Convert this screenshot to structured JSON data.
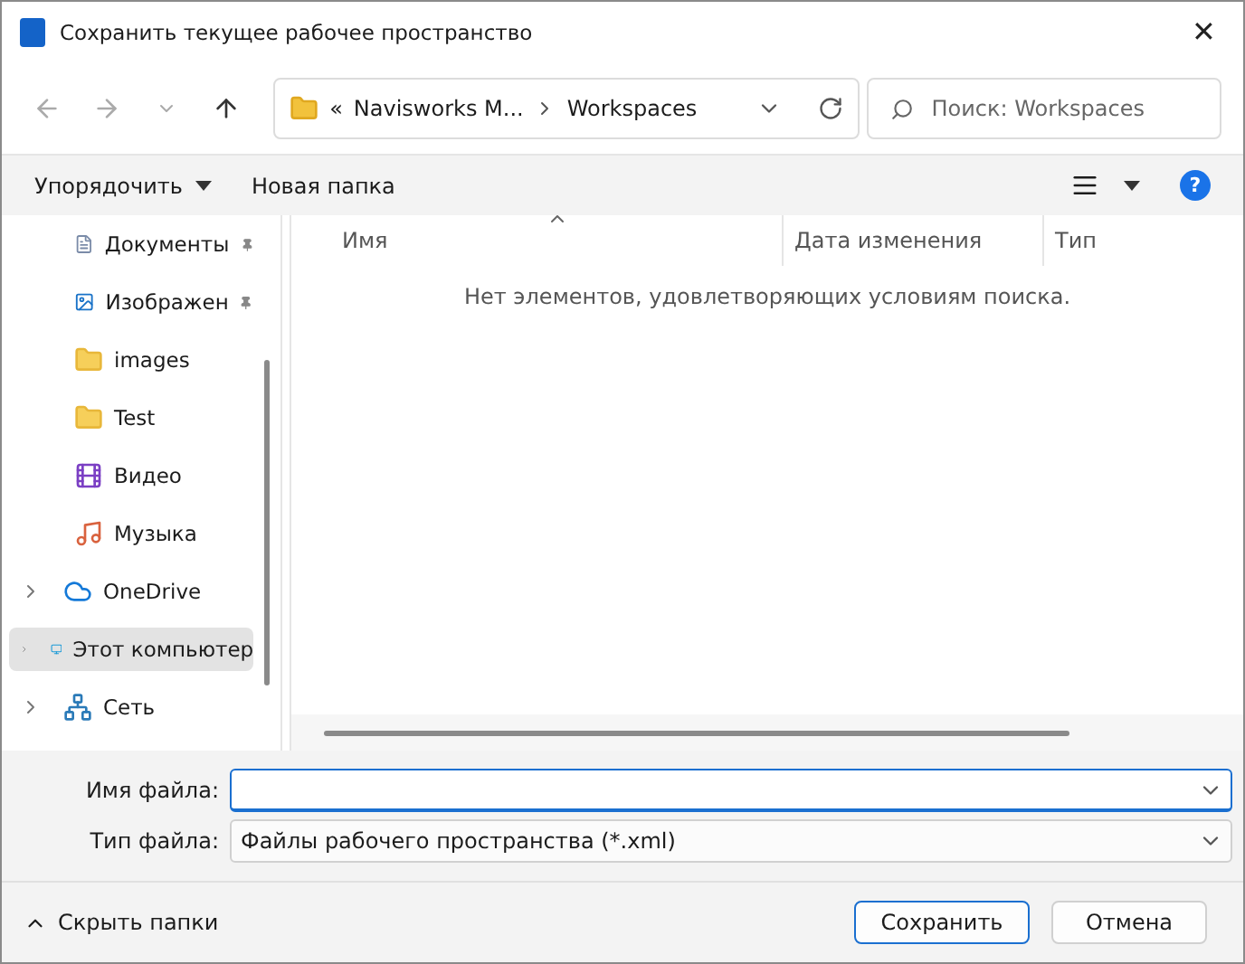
{
  "window": {
    "title": "Сохранить текущее рабочее пространство",
    "close": "✕"
  },
  "address": {
    "overflow": "«",
    "segments": [
      "Navisworks M...",
      "Workspaces"
    ]
  },
  "search": {
    "placeholder": "Поиск: Workspaces"
  },
  "toolbar": {
    "organize": "Упорядочить",
    "new_folder": "Новая папка",
    "help": "?"
  },
  "sidebar": {
    "items": [
      {
        "label": "Документы",
        "kind": "documents",
        "pinned": true,
        "expandable": false,
        "selected": false
      },
      {
        "label": "Изображен",
        "kind": "pictures",
        "pinned": true,
        "expandable": false,
        "selected": false
      },
      {
        "label": "images",
        "kind": "folder",
        "pinned": false,
        "expandable": false,
        "selected": false
      },
      {
        "label": "Test",
        "kind": "folder",
        "pinned": false,
        "expandable": false,
        "selected": false
      },
      {
        "label": "Видео",
        "kind": "video",
        "pinned": false,
        "expandable": false,
        "selected": false
      },
      {
        "label": "Музыка",
        "kind": "music",
        "pinned": false,
        "expandable": false,
        "selected": false
      },
      {
        "label": "OneDrive",
        "kind": "cloud",
        "pinned": false,
        "expandable": true,
        "selected": false
      },
      {
        "label": "Этот компьютер",
        "kind": "computer",
        "pinned": false,
        "expandable": true,
        "selected": true
      },
      {
        "label": "Сеть",
        "kind": "network",
        "pinned": false,
        "expandable": true,
        "selected": false
      }
    ]
  },
  "table": {
    "columns": [
      "Имя",
      "Дата изменения",
      "Тип"
    ],
    "empty_message": "Нет элементов, удовлетворяющих условиям поиска."
  },
  "form": {
    "file_name": {
      "label": "Имя файла:"
    },
    "file_type": {
      "label": "Тип файла:",
      "value": "Файлы рабочего пространства (*.xml)"
    }
  },
  "footer": {
    "hide_folders": "Скрыть папки",
    "buttons": [
      {
        "label": "Сохранить",
        "default": true
      },
      {
        "label": "Отмена",
        "default": false
      }
    ]
  }
}
